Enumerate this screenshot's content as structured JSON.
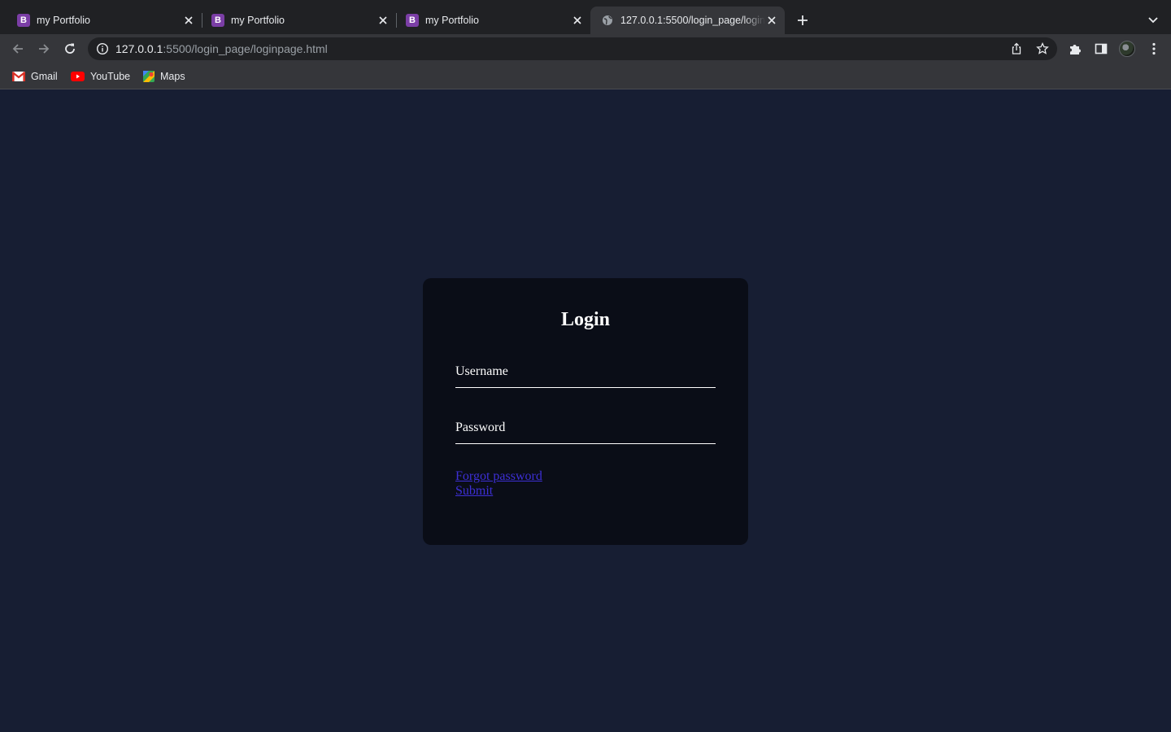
{
  "browser": {
    "tabs": [
      {
        "title": "my Portfolio",
        "favicon": "B"
      },
      {
        "title": "my Portfolio",
        "favicon": "B"
      },
      {
        "title": "my Portfolio",
        "favicon": "B"
      },
      {
        "title": "127.0.0.1:5500/login_page/loginpage.html",
        "favicon": "globe-icon",
        "active": true
      }
    ],
    "url_host": "127.0.0.1",
    "url_rest": ":5500/login_page/loginpage.html",
    "bookmarks": [
      {
        "label": "Gmail",
        "icon": "gmail-icon"
      },
      {
        "label": "YouTube",
        "icon": "youtube-icon"
      },
      {
        "label": "Maps",
        "icon": "maps-icon"
      }
    ]
  },
  "login": {
    "title": "Login",
    "username_label": "Username",
    "password_label": "Password",
    "forgot_password": "Forgot password",
    "submit": "Submit"
  },
  "colors": {
    "page_bg": "#171e33",
    "card_bg": "#0a0d17",
    "link": "#3d2fd6",
    "favicon_bootstrap": "#7b3ea6"
  }
}
